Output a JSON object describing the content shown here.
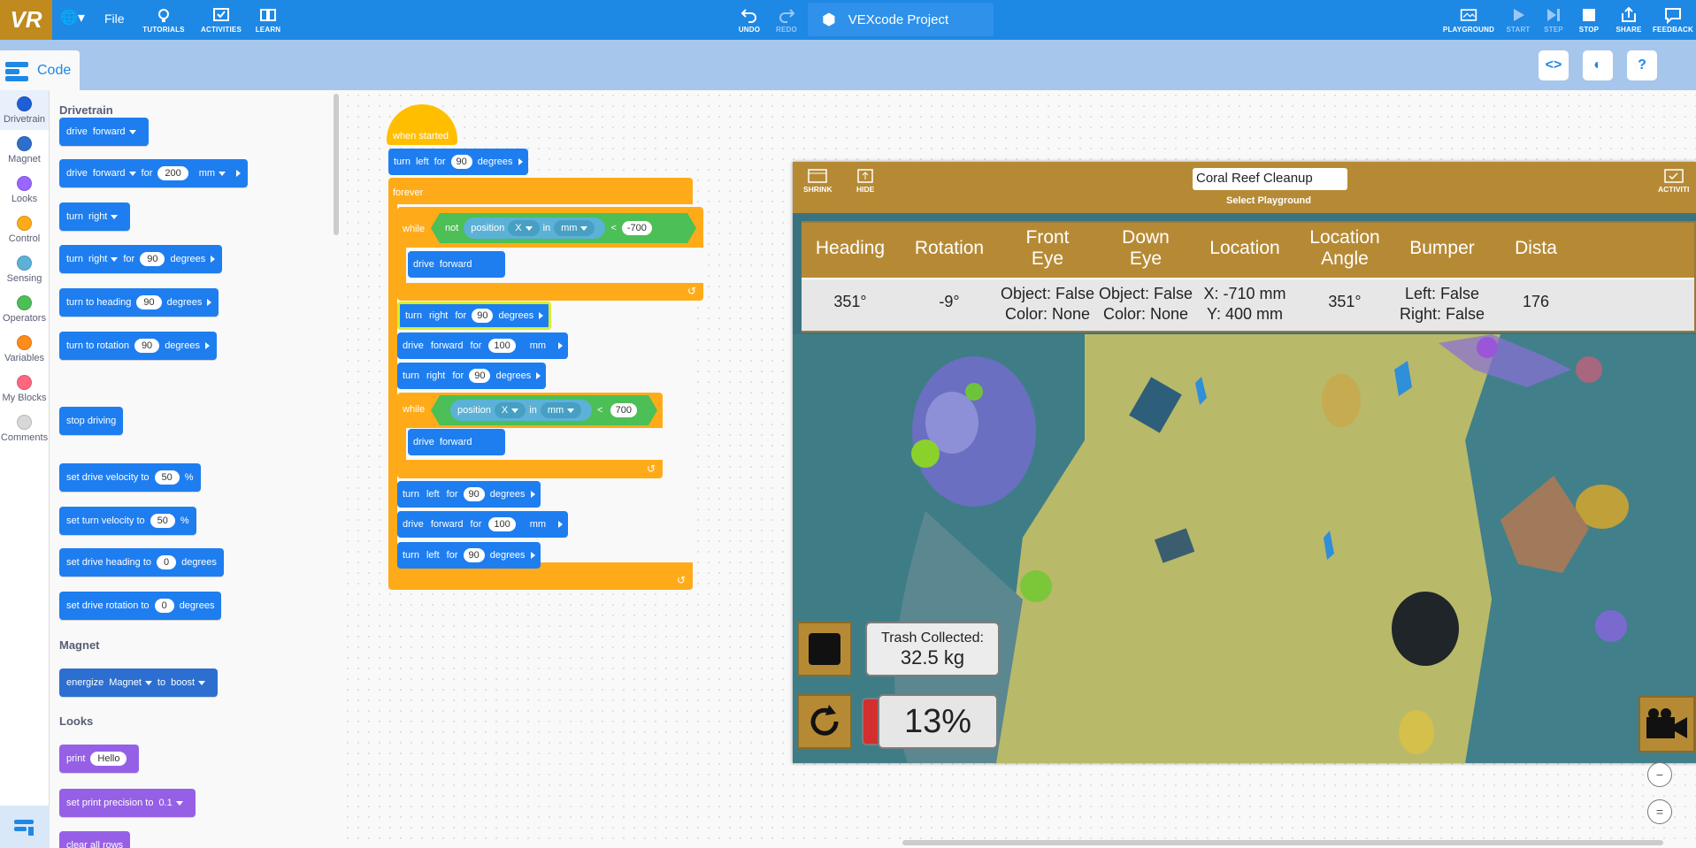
{
  "topbar": {
    "logo": "VR",
    "file": "File",
    "tutorials": "TUTORIALS",
    "activities": "ACTIVITIES",
    "learn": "LEARN",
    "undo": "UNDO",
    "redo": "REDO",
    "project_name": "VEXcode Project",
    "playground": "PLAYGROUND",
    "start": "START",
    "step": "STEP",
    "stop": "STOP",
    "share": "SHARE",
    "feedback": "FEEDBACK"
  },
  "code_tab": "Code",
  "categories": [
    "Drivetrain",
    "Magnet",
    "Looks",
    "Control",
    "Sensing",
    "Operators",
    "Variables",
    "My Blocks",
    "Comments"
  ],
  "category_colors": [
    "#1e5fd6",
    "#2e6fcc",
    "#9966ff",
    "#ffab19",
    "#5cb1d6",
    "#4cbf56",
    "#ff8c1a",
    "#ff6680",
    "#d8d8d8"
  ],
  "flyout": {
    "drivetrain_title": "Drivetrain",
    "magnet_title": "Magnet",
    "looks_title": "Looks",
    "drive": "drive",
    "forward": "forward",
    "for": "for",
    "mm": "mm",
    "v200": "200",
    "turn": "turn",
    "right": "right",
    "v90": "90",
    "degrees": "degrees",
    "turn_to_heading": "turn to heading",
    "turn_to_rotation": "turn to rotation",
    "stop_driving": "stop driving",
    "set_drive_velocity": "set drive velocity to",
    "set_turn_velocity": "set turn velocity to",
    "v50": "50",
    "pct": "%",
    "set_drive_heading": "set drive heading to",
    "set_drive_rotation": "set drive rotation to",
    "v0": "0",
    "energize": "energize",
    "magnet_dd": "Magnet",
    "to": "to",
    "boost": "boost",
    "print": "print",
    "hello": "Hello",
    "set_print_precision": "set print precision to",
    "v01": "0.1",
    "clear_all_rows": "clear all rows"
  },
  "script": {
    "when_started": "when started",
    "turn": "turn",
    "left": "left",
    "right": "right",
    "for": "for",
    "v90": "90",
    "degrees": "degrees",
    "forever": "forever",
    "while": "while",
    "not": "not",
    "position": "position",
    "x": "X",
    "in": "in",
    "mm": "mm",
    "lt": "<",
    "neg700": "-700",
    "v700": "700",
    "drive": "drive",
    "forward": "forward",
    "v100": "100"
  },
  "playground": {
    "shrink": "SHRINK",
    "hide": "HIDE",
    "title": "Coral Reef Cleanup",
    "select": "Select Playground",
    "activities": "ACTIVITI",
    "headers": [
      "Heading",
      "Rotation",
      "Front\nEye",
      "Down\nEye",
      "Location",
      "Location\nAngle",
      "Bumper",
      "Dista"
    ],
    "values": [
      "351°",
      "-9°",
      "Object: False\nColor: None",
      "Object: False\nColor: None",
      "X: -710 mm\nY: 400 mm",
      "351°",
      "Left: False\nRight: False",
      "176"
    ],
    "trash_label": "Trash Collected:",
    "trash_value": "32.5 kg",
    "percent": "13%",
    "progress_fraction": 0.13
  }
}
